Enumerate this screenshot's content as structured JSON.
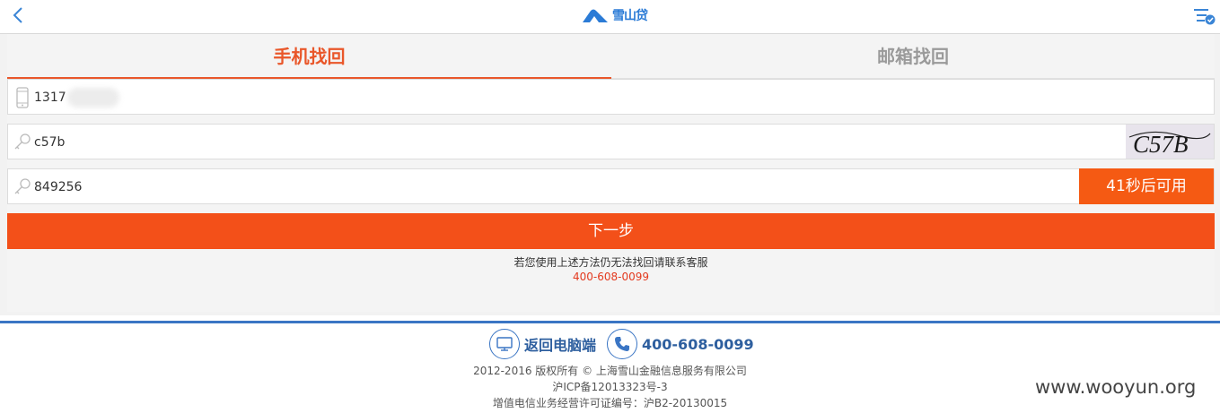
{
  "header": {
    "logo_text": "雪山贷"
  },
  "tabs": [
    {
      "label": "手机找回"
    },
    {
      "label": "邮箱找回"
    }
  ],
  "form": {
    "phone_value": "1317",
    "captcha_value": "c57b",
    "captcha_image_text": "C57B",
    "sms_code_value": "849256",
    "sms_button_label": "41秒后可用",
    "next_button_label": "下一步"
  },
  "help": {
    "text": "若您使用上述方法仍无法找回请联系客服",
    "phone": "400-608-0099"
  },
  "footer": {
    "desktop_link": "返回电脑端",
    "phone": "400-608-0099",
    "copyright": "2012-2016 版权所有 © 上海雪山金融信息服务有限公司",
    "icp": "沪ICP备12013323号-3",
    "license": "增值电信业务经营许可证编号：沪B2-20130015"
  },
  "watermark": "www.wooyun.org",
  "colors": {
    "accent": "#f35019",
    "tab_active": "#e9572a",
    "brand_blue": "#3a75c4",
    "help_phone": "#e33a1f"
  }
}
